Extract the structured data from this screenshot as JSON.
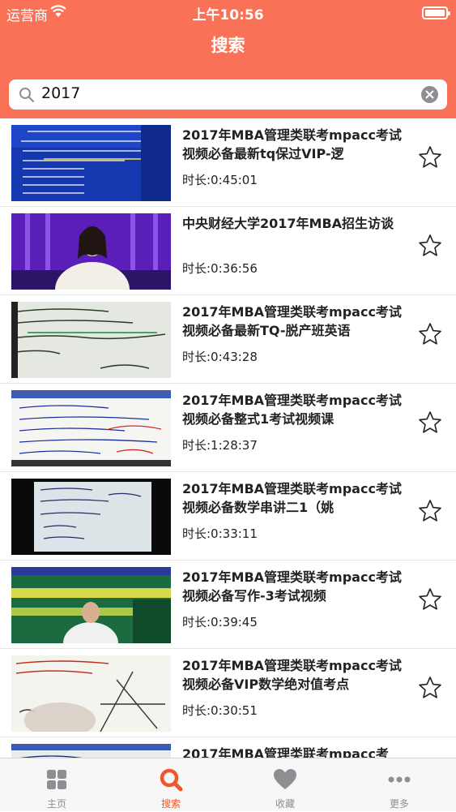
{
  "status_bar": {
    "carrier": "运营商",
    "time": "上午10:56"
  },
  "nav": {
    "title": "搜索"
  },
  "search": {
    "value": "2017"
  },
  "results": [
    {
      "title": "2017年MBA管理类联考mpacc考试视频必备最新tq保过VIP-逻",
      "duration": "时长:0:45:01"
    },
    {
      "title": "中央财经大学2017年MBA招生访谈",
      "duration": "时长:0:36:56"
    },
    {
      "title": "2017年MBA管理类联考mpacc考试视频必备最新TQ-脱产班英语",
      "duration": "时长:0:43:28"
    },
    {
      "title": "2017年MBA管理类联考mpacc考试视频必备整式1考试视频课",
      "duration": "时长:1:28:37"
    },
    {
      "title": "2017年MBA管理类联考mpacc考试视频必备数学串讲二1（姚",
      "duration": "时长:0:33:11"
    },
    {
      "title": "2017年MBA管理类联考mpacc考试视频必备写作-3考试视频",
      "duration": "时长:0:39:45"
    },
    {
      "title": "2017年MBA管理类联考mpacc考试视频必备VIP数学绝对值考点",
      "duration": "时长:0:30:51"
    },
    {
      "title": "2017年MBA管理类联考mpacc考",
      "duration": ""
    }
  ],
  "tabs": [
    {
      "label": "主页",
      "icon": "grid-icon"
    },
    {
      "label": "搜索",
      "icon": "search-icon"
    },
    {
      "label": "收藏",
      "icon": "heart-icon"
    },
    {
      "label": "更多",
      "icon": "more-dots-icon"
    }
  ],
  "colors": {
    "accent": "#f97257",
    "active_tab": "#f0562f",
    "inactive_tab": "#8e8e93"
  }
}
